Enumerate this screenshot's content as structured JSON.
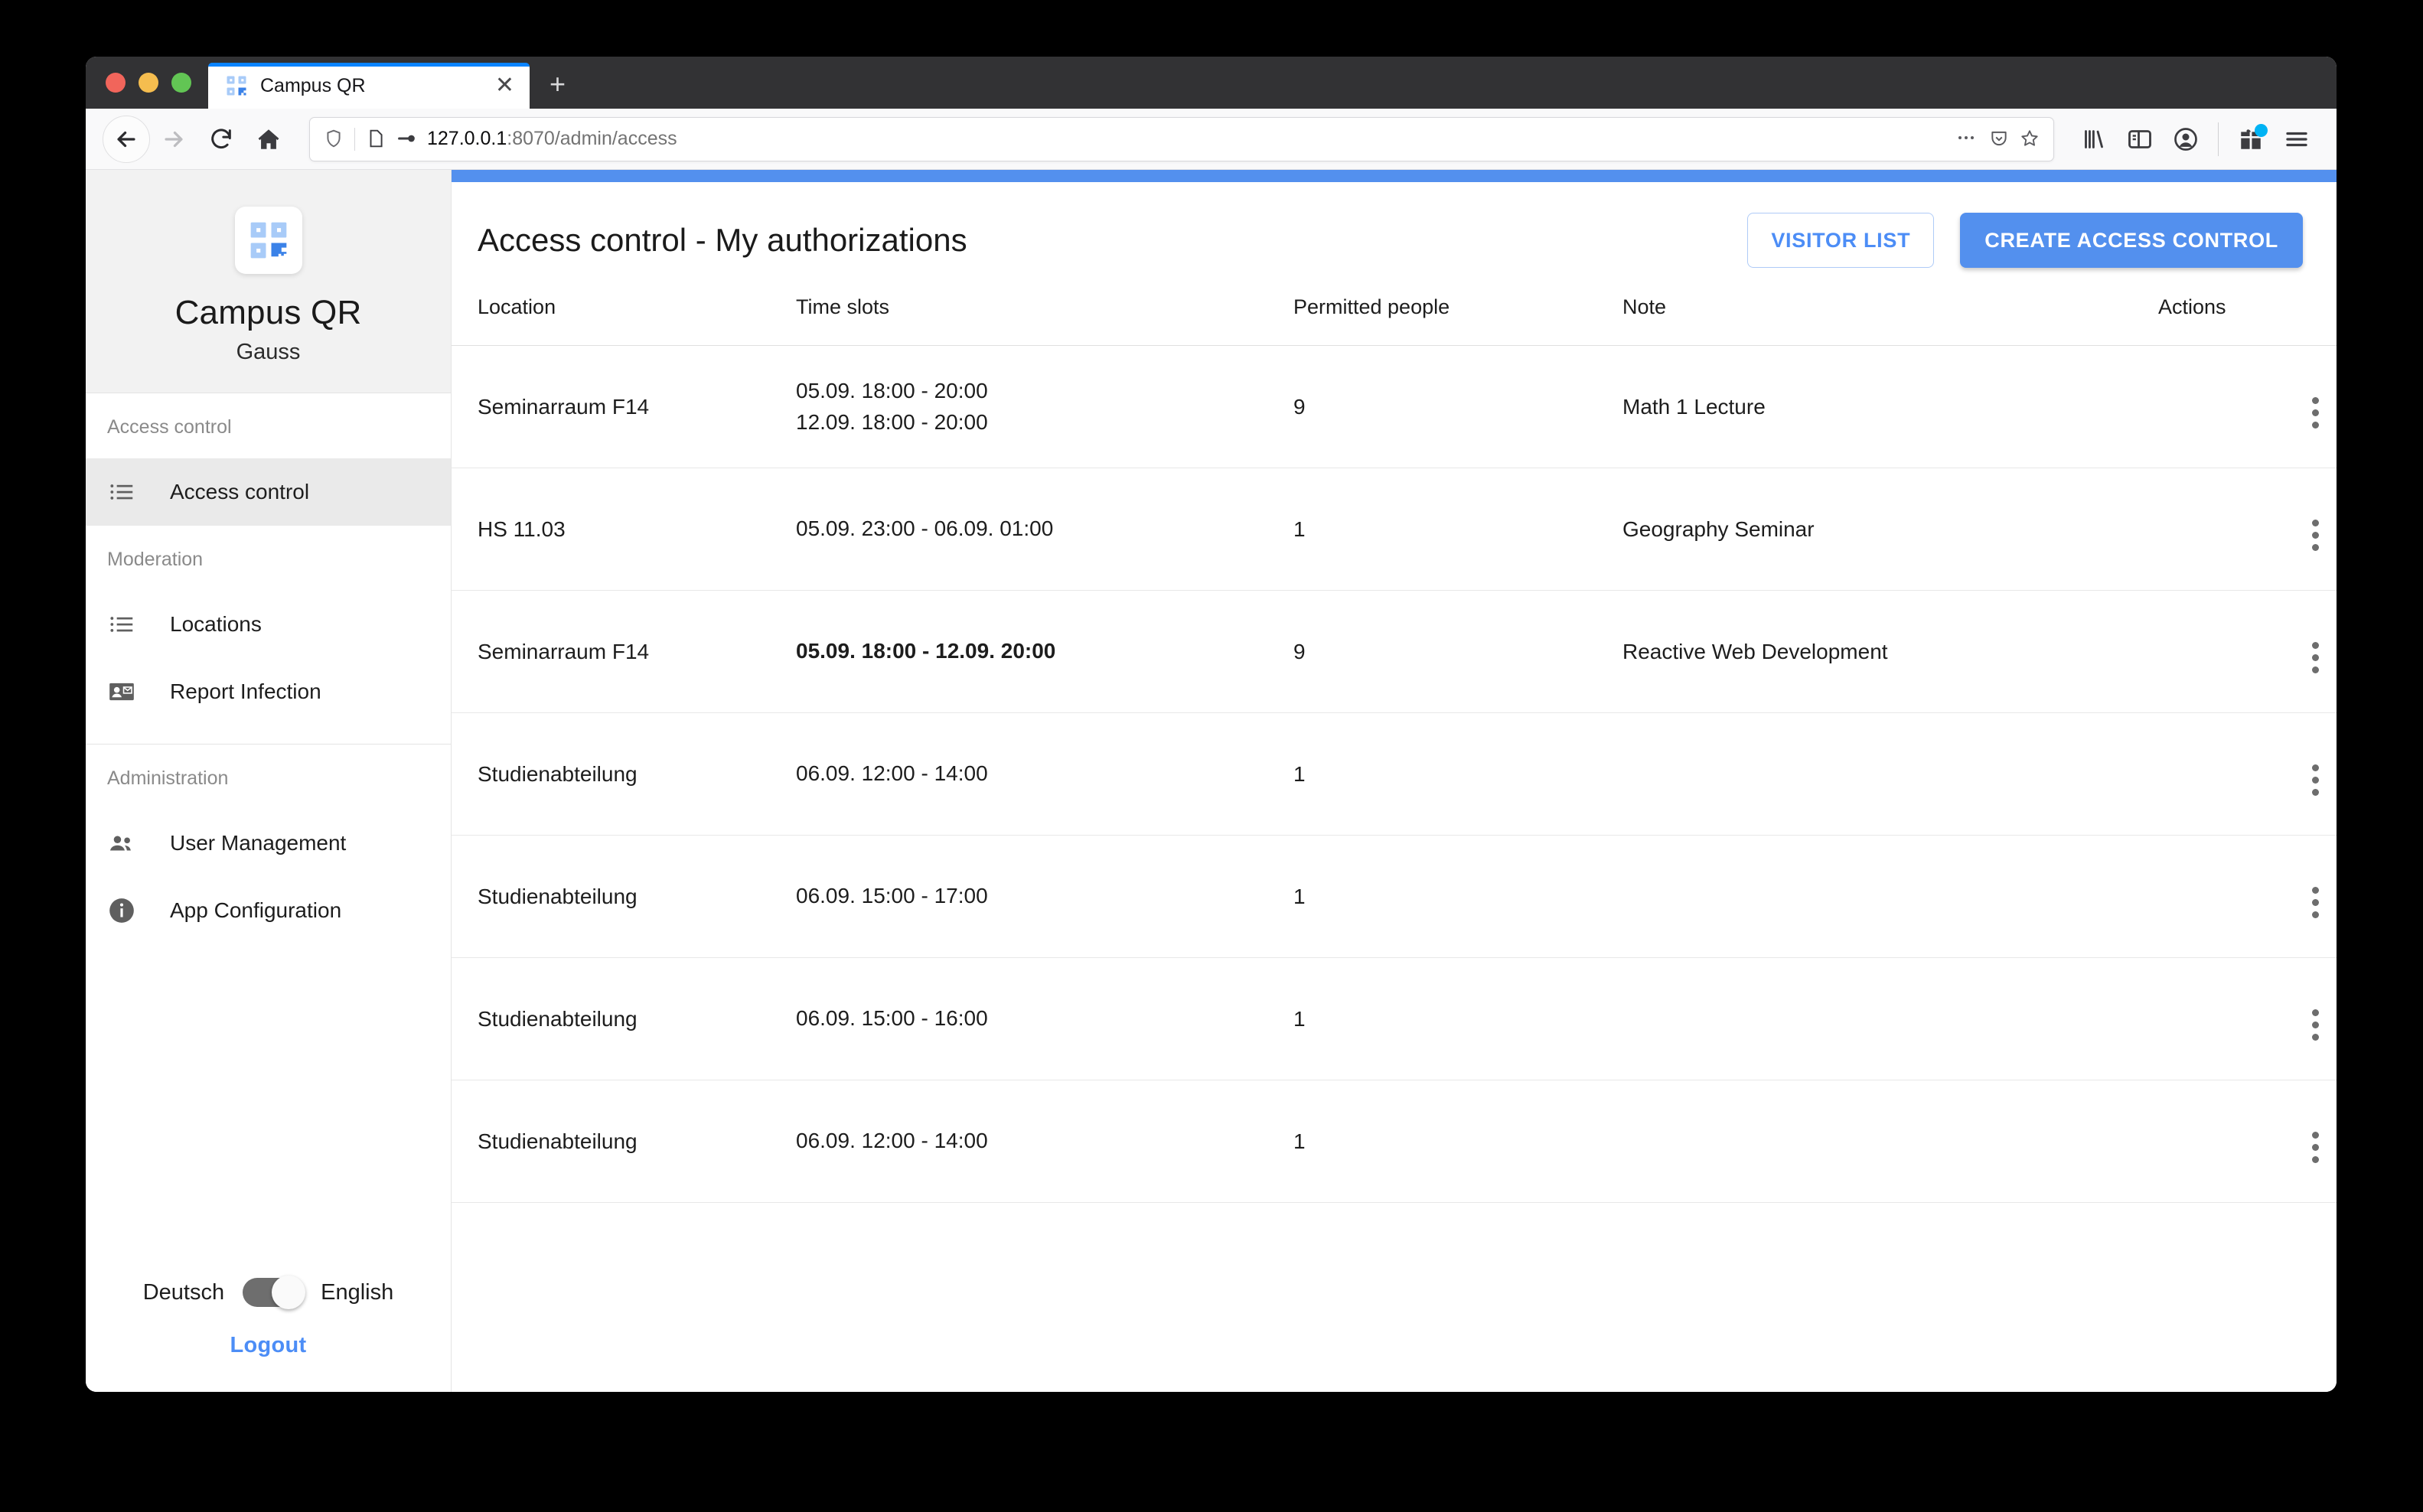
{
  "browser": {
    "tab": {
      "title": "Campus QR",
      "favicon_icon": "qr-code-favicon",
      "close_icon": "close-icon"
    },
    "new_tab_icon": "plus-icon",
    "nav": {
      "back_icon": "arrow-left-icon",
      "forward_icon": "arrow-right-icon",
      "reload_icon": "reload-icon",
      "home_icon": "home-icon"
    },
    "url": {
      "host": "127.0.0.1",
      "rest": ":8070/admin/access",
      "full": "127.0.0.1:8070/admin/access",
      "shield_icon": "shield-icon",
      "page_icon": "page-icon",
      "permissions_icon": "key-permissions-icon",
      "more_icon": "ellipsis-icon",
      "pocket_icon": "pocket-icon",
      "bookmark_icon": "star-icon"
    },
    "toolbar_right": {
      "library_icon": "library-icon",
      "sidebar_icon": "sidebar-icon",
      "account_icon": "account-icon",
      "gift_icon": "gift-icon",
      "menu_icon": "hamburger-menu-icon"
    }
  },
  "sidebar": {
    "app_name": "Campus QR",
    "app_subtitle": "Gauss",
    "logo_icon": "qr-code-logo",
    "sections": [
      {
        "label": "Access control",
        "items": [
          {
            "label": "Access control",
            "icon": "list-icon",
            "active": true
          }
        ]
      },
      {
        "label": "Moderation",
        "items": [
          {
            "label": "Locations",
            "icon": "list-icon",
            "active": false
          },
          {
            "label": "Report Infection",
            "icon": "contact-mail-icon",
            "active": false
          }
        ]
      },
      {
        "label": "Administration",
        "items": [
          {
            "label": "User Management",
            "icon": "people-icon",
            "active": false
          },
          {
            "label": "App Configuration",
            "icon": "info-icon",
            "active": false
          }
        ]
      }
    ],
    "footer": {
      "lang_left": "Deutsch",
      "lang_right": "English",
      "lang_selected": "English",
      "logout_label": "Logout"
    }
  },
  "main": {
    "accent_color": "#5390EE",
    "page_title": "Access control - My authorizations",
    "visitor_list_label": "VISITOR LIST",
    "create_access_control_label": "CREATE ACCESS CONTROL",
    "table": {
      "columns": [
        "Location",
        "Time slots",
        "Permitted people",
        "Note",
        "Actions"
      ],
      "rows": [
        {
          "location": "Seminarraum F14",
          "time_slots": [
            "05.09. 18:00 - 20:00",
            "12.09. 18:00 - 20:00"
          ],
          "time_slots_bold": false,
          "permitted_people": "9",
          "note": "Math 1 Lecture",
          "actions_icon": "kebab-menu-icon"
        },
        {
          "location": "HS 11.03",
          "time_slots": [
            "05.09. 23:00 - 06.09. 01:00"
          ],
          "time_slots_bold": false,
          "permitted_people": "1",
          "note": "Geography Seminar",
          "actions_icon": "kebab-menu-icon"
        },
        {
          "location": "Seminarraum F14",
          "time_slots": [
            "05.09. 18:00 - 12.09. 20:00"
          ],
          "time_slots_bold": true,
          "permitted_people": "9",
          "note": "Reactive Web Development",
          "actions_icon": "kebab-menu-icon"
        },
        {
          "location": "Studienabteilung",
          "time_slots": [
            "06.09. 12:00 - 14:00"
          ],
          "time_slots_bold": false,
          "permitted_people": "1",
          "note": "",
          "actions_icon": "kebab-menu-icon"
        },
        {
          "location": "Studienabteilung",
          "time_slots": [
            "06.09. 15:00 - 17:00"
          ],
          "time_slots_bold": false,
          "permitted_people": "1",
          "note": "",
          "actions_icon": "kebab-menu-icon"
        },
        {
          "location": "Studienabteilung",
          "time_slots": [
            "06.09. 15:00 - 16:00"
          ],
          "time_slots_bold": false,
          "permitted_people": "1",
          "note": "",
          "actions_icon": "kebab-menu-icon"
        },
        {
          "location": "Studienabteilung",
          "time_slots": [
            "06.09. 12:00 - 14:00"
          ],
          "time_slots_bold": false,
          "permitted_people": "1",
          "note": "",
          "actions_icon": "kebab-menu-icon"
        }
      ]
    }
  }
}
